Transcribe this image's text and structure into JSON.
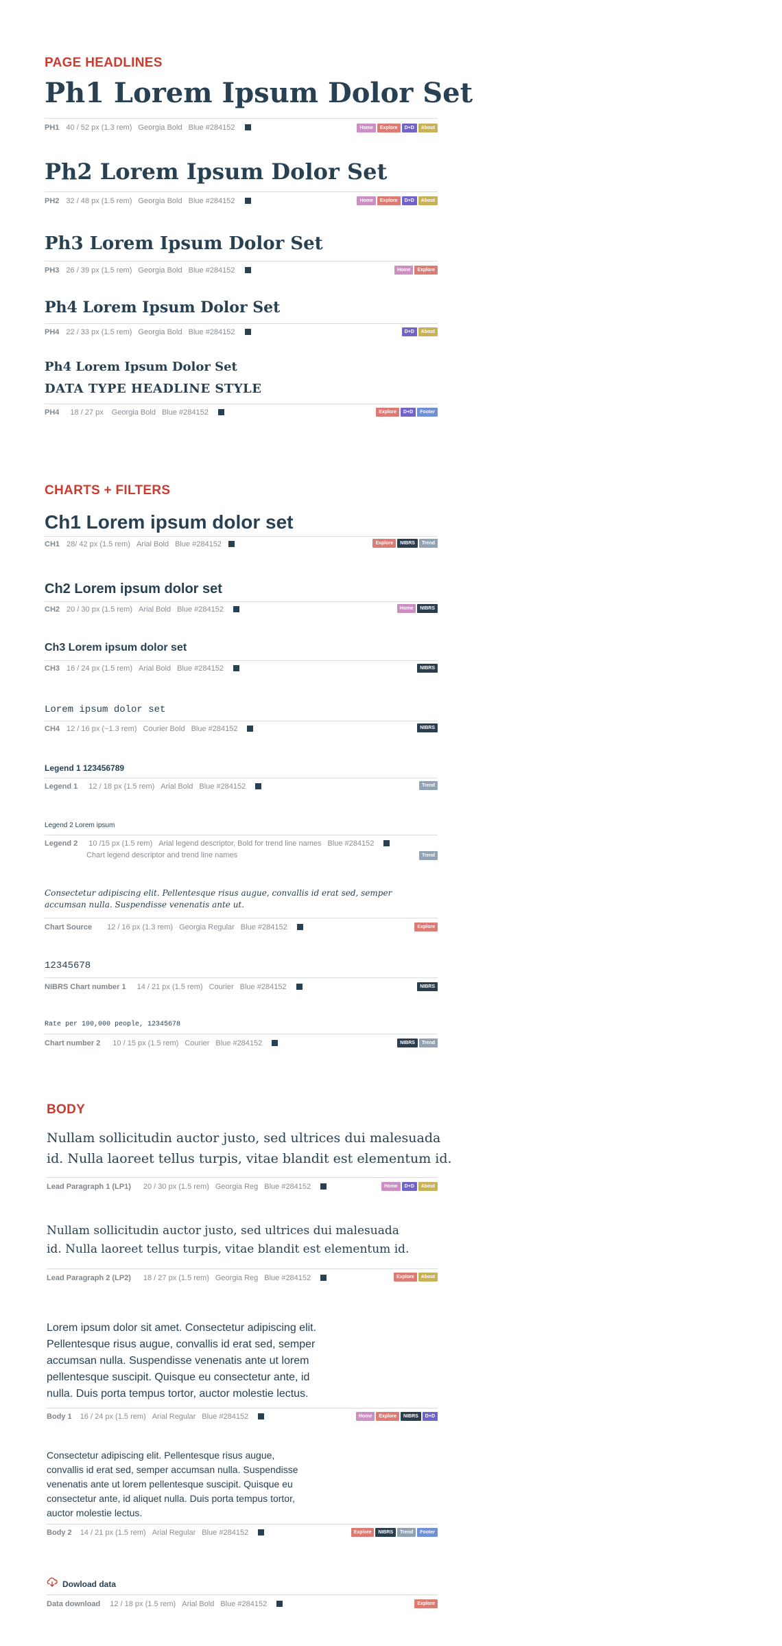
{
  "colors": {
    "accent": "#cc3b30",
    "blue": "#284152",
    "tag_home": "#cc8fc4",
    "tag_explore": "#dc7b73",
    "tag_dd": "#7164c8",
    "tag_about": "#c9b157",
    "tag_nibrs": "#2b3e50",
    "tag_trend": "#8fa3b4",
    "tag_footer": "#6f8fd6"
  },
  "tags": {
    "home": "Home",
    "explore": "Explore",
    "dd": "D+D",
    "about": "About",
    "nibrs": "NIBRS",
    "trend": "Trend",
    "footer": "Footer"
  },
  "headlines": {
    "title": "PAGE HEADLINES",
    "ph1": {
      "sample": "Ph1 Lorem Ipsum Dolor Set",
      "label": "PH1",
      "size": "40 / 52 px (1.3 rem)",
      "font": "Georgia Bold",
      "color": "Blue #284152"
    },
    "ph2": {
      "sample": "Ph2 Lorem Ipsum Dolor Set",
      "label": "PH2",
      "size": "32 / 48 px (1.5 rem)",
      "font": "Georgia Bold",
      "color": "Blue #284152"
    },
    "ph3": {
      "sample": "Ph3 Lorem Ipsum Dolor Set",
      "label": "PH3",
      "size": "26 / 39 px (1.5 rem)",
      "font": "Georgia Bold",
      "color": "Blue #284152"
    },
    "ph4": {
      "sample": "Ph4 Lorem Ipsum Dolor Set",
      "label": "PH4",
      "size": "22 / 33 px (1.5 rem)",
      "font": "Georgia Bold",
      "color": "Blue #284152"
    },
    "ph4b": {
      "sample": "Ph4 Lorem Ipsum Dolor Set",
      "sample2": "DATA TYPE HEADLINE STYLE",
      "label": "PH4",
      "size": "18 / 27 px",
      "font": "Georgia Bold",
      "color": "Blue #284152"
    }
  },
  "charts": {
    "title": "CHARTS + FILTERS",
    "ch1": {
      "sample": "Ch1 Lorem ipsum dolor set",
      "label": "CH1",
      "size": "28/ 42 px (1.5 rem)",
      "font": "Arial Bold",
      "color": "Blue #284152"
    },
    "ch2": {
      "sample": "Ch2 Lorem ipsum dolor set",
      "label": "CH2",
      "size": "20 / 30 px (1.5 rem)",
      "font": "Arial Bold",
      "color": "Blue #284152"
    },
    "ch3": {
      "sample": "Ch3 Lorem ipsum dolor set",
      "label": "CH3",
      "size": "16 / 24 px (1.5  rem)",
      "font": "Arial Bold",
      "color": "Blue #284152"
    },
    "ch4": {
      "sample": "Lorem ipsum dolor set",
      "label": "CH4",
      "size": "12 / 16 px (~1.3 rem)",
      "font": "Courier Bold",
      "color": "Blue #284152"
    },
    "legend1": {
      "sample": "Legend 1 123456789",
      "label": "Legend 1",
      "size": "12 / 18 px (1.5 rem)",
      "font": "Arial Bold",
      "color": "Blue #284152"
    },
    "legend2": {
      "sample": "Legend 2 Lorem ipsum",
      "label": "Legend 2",
      "size": "10 /15 px (1.5 rem)",
      "font": "Arial legend descriptor, Bold for trend line names",
      "color": "Blue #284152",
      "note": "Chart legend descriptor and trend line names"
    },
    "source": {
      "sample_line1": "Consectetur adipiscing elit. Pellentesque risus augue, convallis id erat sed, semper",
      "sample_line2": "accumsan nulla. Suspendisse venenatis ante ut.",
      "label": "Chart Source",
      "size": "12 / 16 px (1.3 rem)",
      "font": "Georgia Regular",
      "color": "Blue #284152"
    },
    "number1": {
      "sample": "12345678",
      "label": "NIBRS Chart number 1",
      "size": "14 / 21 px (1.5 rem)",
      "font": "Courier",
      "color": "Blue #284152"
    },
    "number2": {
      "sample": "Rate per 100,000 people, 12345678",
      "label": "Chart number 2",
      "size": "10 / 15 px (1.5 rem)",
      "font": "Courier",
      "color": "Blue #284152"
    }
  },
  "body": {
    "title": "BODY",
    "lp1": {
      "line1": "Nullam sollicitudin auctor justo, sed ultrices dui malesuada",
      "line2": "id. Nulla laoreet tellus turpis, vitae blandit est elementum id.",
      "label": "Lead Paragraph 1 (LP1)",
      "size": "20 / 30 px (1.5 rem)",
      "font": "Georgia Reg",
      "color": "Blue #284152"
    },
    "lp2": {
      "line1": "Nullam sollicitudin auctor justo, sed ultrices dui malesuada",
      "line2": "id. Nulla laoreet tellus turpis, vitae blandit est elementum id.",
      "label": "Lead Paragraph 2 (LP2)",
      "size": "18 / 27 px (1.5 rem)",
      "font": "Georgia Reg",
      "color": "Blue #284152"
    },
    "body1": {
      "lines": [
        "Lorem ipsum dolor sit amet. Consectetur adipiscing elit.",
        "Pellentesque risus augue, convallis id erat sed, semper",
        "accumsan nulla. Suspendisse venenatis ante ut lorem",
        "pellentesque suscipit. Quisque eu consectetur ante, id",
        "nulla. Duis porta tempus tortor, auctor molestie lectus."
      ],
      "label": "Body 1",
      "size": "16 / 24 px (1.5 rem)",
      "font": "Arial Regular",
      "color": "Blue #284152"
    },
    "body2": {
      "lines": [
        "Consectetur adipiscing elit. Pellentesque risus augue,",
        "convallis id erat sed, semper accumsan nulla. Suspendisse",
        "venenatis ante ut lorem pellentesque suscipit. Quisque eu",
        "consectetur ante, id aliquet nulla. Duis porta tempus tortor,",
        "auctor molestie lectus."
      ],
      "label": "Body 2",
      "size": "14 / 21 px (1.5 rem)",
      "font": "Arial Regular",
      "color": "Blue #284152"
    },
    "download": {
      "sample": "Dowload data",
      "icon": "cloud-download-icon",
      "label": "Data download",
      "size": "12 / 18 px (1.5 rem)",
      "font": "Arial Bold",
      "color": "Blue #284152"
    }
  }
}
